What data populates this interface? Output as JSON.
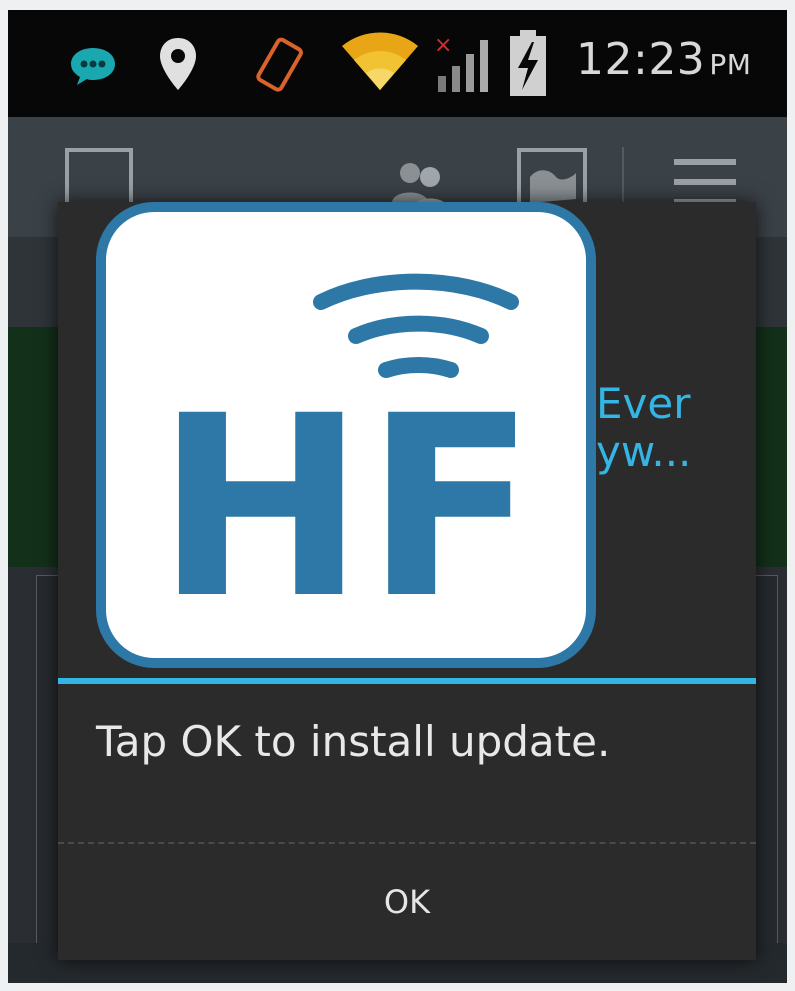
{
  "status_bar": {
    "time": "12:23",
    "ampm": "PM",
    "icons": [
      "chat-bubble-icon",
      "location-pin-icon",
      "screen-rotation-icon",
      "wifi-icon",
      "signal-no-service-icon",
      "battery-charging-icon"
    ]
  },
  "action_bar": {
    "icons": [
      "checkbox-icon",
      "contacts-icon",
      "map-icon",
      "menu-icon"
    ]
  },
  "dialog": {
    "title": "Ever yw...",
    "app_icon_text": "HF",
    "message": "Tap OK to install update.",
    "ok_label": "OK"
  },
  "colors": {
    "accent": "#33b5e5",
    "icon_blue": "#2e78a8",
    "dialog_bg": "#2b2b2b"
  }
}
